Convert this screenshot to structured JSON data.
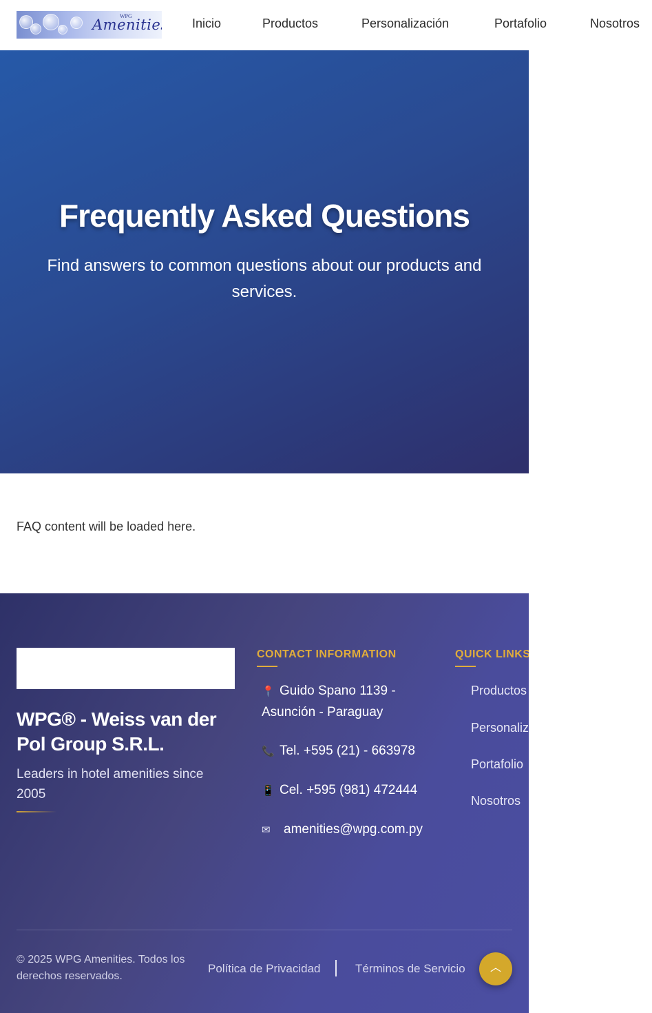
{
  "header": {
    "logo": {
      "brand": "Amenities",
      "brand_small": "WPG"
    },
    "nav": [
      {
        "label": "Inicio"
      },
      {
        "label": "Productos"
      },
      {
        "label": "Personalización"
      },
      {
        "label": "Portafolio"
      },
      {
        "label": "Nosotros"
      }
    ]
  },
  "hero": {
    "title": "Frequently Asked Questions",
    "subtitle": "Find answers to common questions about our products and services."
  },
  "faq": {
    "placeholder": "FAQ content will be loaded here."
  },
  "footer": {
    "company": "WPG® - Weiss van der Pol Group S.R.L.",
    "tagline": "Leaders in hotel amenities since 2005",
    "contact": {
      "heading": "CONTACT INFORMATION",
      "address": "Guido Spano 1139 - Asunción - Paraguay",
      "phone": "Tel. +595 (21) - 663978",
      "cell": "Cel. +595 (981) 472444",
      "email": "amenities@wpg.com.py",
      "icons": [
        "map-pin-icon",
        "phone-icon",
        "mobile-phone-icon",
        "envelope-icon"
      ]
    },
    "quick_links": {
      "heading": "QUICK LINKS",
      "items": [
        {
          "label": "Productos"
        },
        {
          "label": "Personalización"
        },
        {
          "label": "Portafolio"
        },
        {
          "label": "Nosotros"
        }
      ]
    },
    "copyright": "© 2025 WPG Amenities. Todos los derechos reservados.",
    "privacy": "Política de Privacidad",
    "terms": "Términos de Servicio",
    "back_to_top_icon": "chevron-up-icon"
  },
  "colors": {
    "accent_gold": "#e0ac3b",
    "hero_start": "#2659a8",
    "hero_end": "#2e2f6b",
    "footer_bg": "#46457e"
  }
}
